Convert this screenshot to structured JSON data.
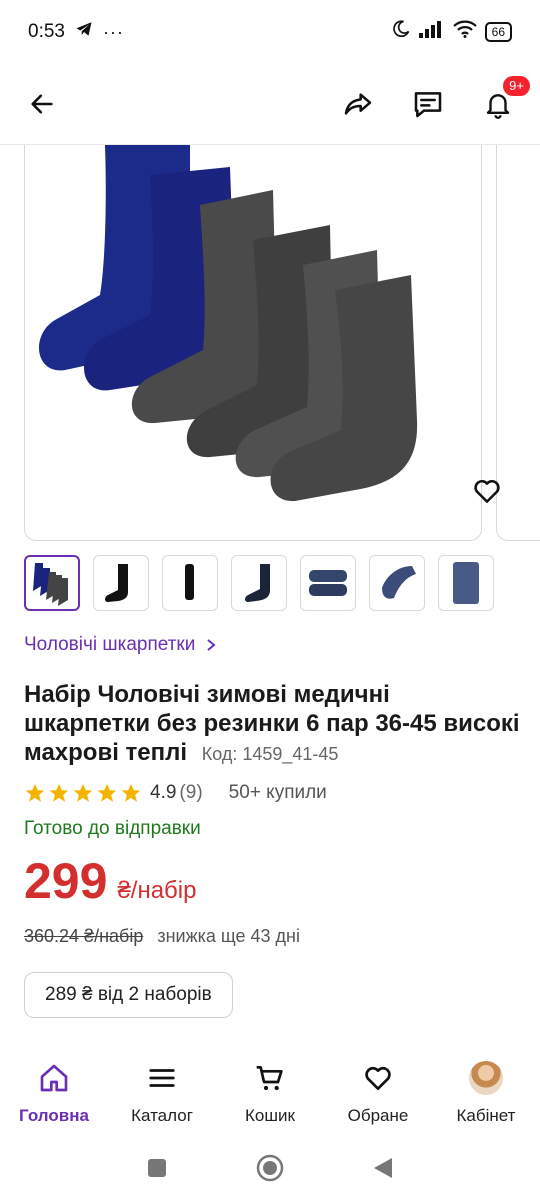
{
  "status_bar": {
    "time": "0:53",
    "battery": "66"
  },
  "header": {
    "notifications_badge": "9+"
  },
  "product": {
    "category_link": "Чоловічі шкарпетки",
    "title": "Набір Чоловічі зимові медичні шкарпетки без резинки 6 пар 36-45 високі махрові теплі",
    "code": "Код: 1459_41-45",
    "rating": "4.9",
    "reviews_count": "(9)",
    "bought": "50+ купили",
    "availability": "Готово до відправки",
    "price": "299",
    "price_unit": "₴/набір",
    "old_price": "360.24 ₴/набір",
    "discount_note": "знижка ще 43 дні",
    "bulk_offer": "289 ₴ від 2 наборів"
  },
  "colors": {
    "accent": "#6a2fb3",
    "price": "#d32f2f",
    "ready": "#1f7a1f",
    "star": "#f5b301",
    "badge": "#f5222d"
  },
  "bottom_nav": {
    "home": "Головна",
    "catalog": "Каталог",
    "cart": "Кошик",
    "favorites": "Обране",
    "cabinet": "Кабінет"
  }
}
